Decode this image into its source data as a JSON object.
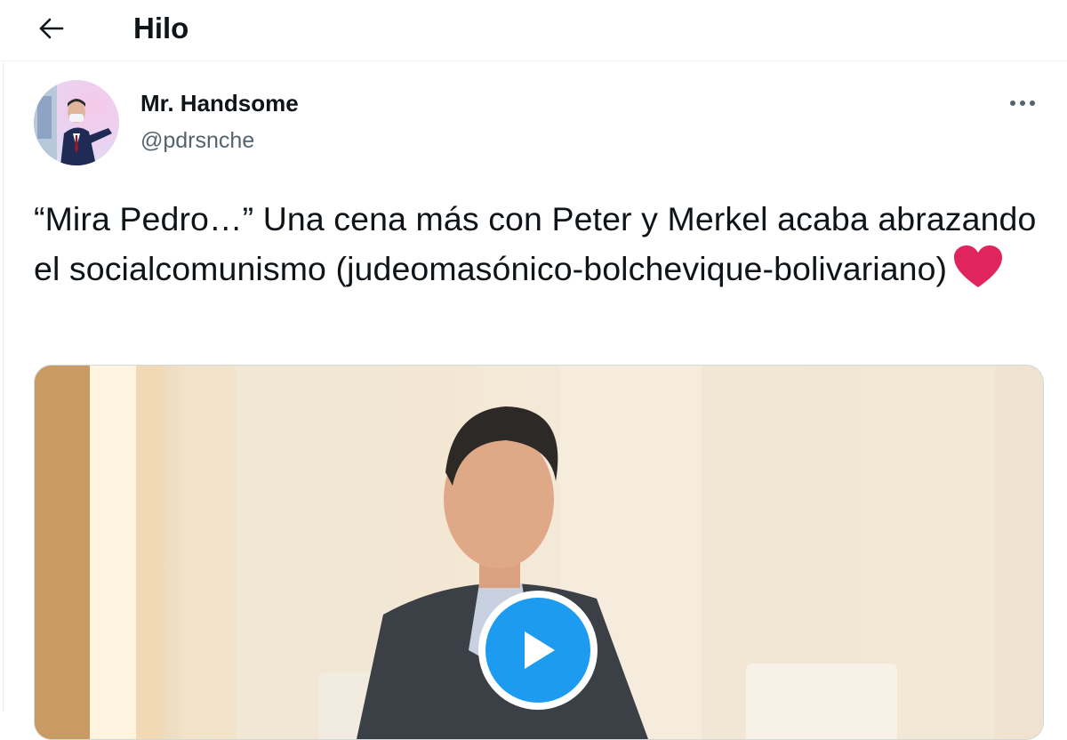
{
  "header": {
    "title": "Hilo",
    "back_icon": "arrow-left-icon"
  },
  "author": {
    "name": "Mr. Handsome",
    "handle": "@pdrsnche",
    "more_icon": "more-dots-icon"
  },
  "tweet": {
    "text": "“Mira Pedro…” Una cena más con Peter y Merkel acaba abrazando el socialcomunismo (judeomasónico-bolchevique-bolivariano)",
    "emoji": "red-heart"
  },
  "media": {
    "type": "video",
    "play_icon": "play-icon"
  },
  "colors": {
    "accent": "#1d9bf0",
    "text": "#0f1419",
    "secondary": "#536471",
    "heart": "#e0245e"
  }
}
